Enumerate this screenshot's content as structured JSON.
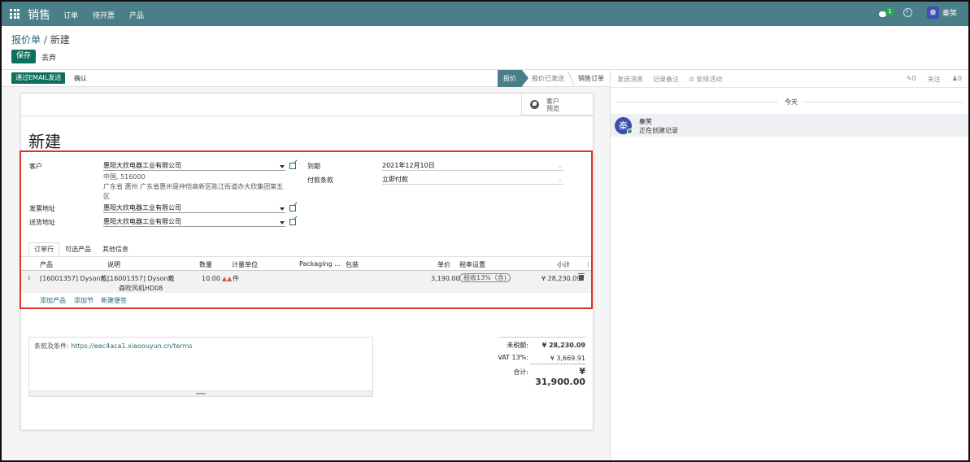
{
  "navbar": {
    "app_title": "销售",
    "menu": [
      "订单",
      "待开票",
      "产品"
    ],
    "messages_count": "1",
    "user_initial": "秦",
    "user_name": "秦笑"
  },
  "control": {
    "breadcrumb_parent": "报价单",
    "breadcrumb_sep": "/",
    "breadcrumb_current": "新建",
    "save_label": "保存",
    "discard_label": "丢弃"
  },
  "statusbar": {
    "email_label": "通过EMAIL发送",
    "confirm_label": "确认",
    "stages": [
      "报价",
      "报价已发送",
      "销售订单"
    ]
  },
  "sheet": {
    "preview_line1": "客户",
    "preview_line2": "预览",
    "title": "新建",
    "customer_label": "客户",
    "customer_value": "惠阳大欣电器工业有限公司",
    "address_line1": "中国, 516000",
    "address_line2": "广东省 惠州 广东省惠州是仲恺高新区陈江街道办大欣集团第五",
    "address_line3": "区",
    "invoice_addr_label": "发票地址",
    "invoice_addr_value": "惠阳大欣电器工业有限公司",
    "delivery_addr_label": "送货地址",
    "delivery_addr_value": "惠阳大欣电器工业有限公司",
    "expiry_label": "到期",
    "expiry_value": "2021年12月10日",
    "payment_terms_label": "付款条款",
    "payment_terms_value": "立即付款",
    "tabs": [
      "订单行",
      "可选产品",
      "其他信息"
    ],
    "columns": {
      "product": "产品",
      "description": "说明",
      "qty": "数量",
      "uom": "计量单位",
      "packaging": "Packaging ...",
      "package": "包装",
      "price": "单价",
      "tax": "税率设置",
      "subtotal": "小计",
      "more": "⁞"
    },
    "line": {
      "product": "[16001357] Dyson戴...",
      "description_1": "[16001357] Dyson戴",
      "description_2": "森吹风机HD08",
      "qty": "10.00",
      "uom": "件",
      "price": "3,190.00",
      "tax": "税收13%（含)",
      "subtotal": "¥ 28,230.09"
    },
    "add_product": "添加产品",
    "add_section": "添加节",
    "add_note": "新建便签",
    "terms_label": "条款及条件: ",
    "terms_link": "https://eec4aca1.xiaoouyun.cn/terms",
    "untaxed_label": "未税额:",
    "untaxed_value": "¥ 28,230.09",
    "vat_label": "VAT 13%:",
    "vat_value": "¥ 3,669.91",
    "total_label": "合计:",
    "total_value": "¥ 31,900.00"
  },
  "chatter": {
    "send_message": "发送消息",
    "log_note": "记录备注",
    "schedule_activity": "⊙ 安排活动",
    "attachments": "✎0",
    "follow": "关注",
    "followers": "♟0",
    "day_label": "今天",
    "msg_avatar": "秦",
    "msg_author": "秦笑",
    "msg_body": "正在创建记录"
  }
}
